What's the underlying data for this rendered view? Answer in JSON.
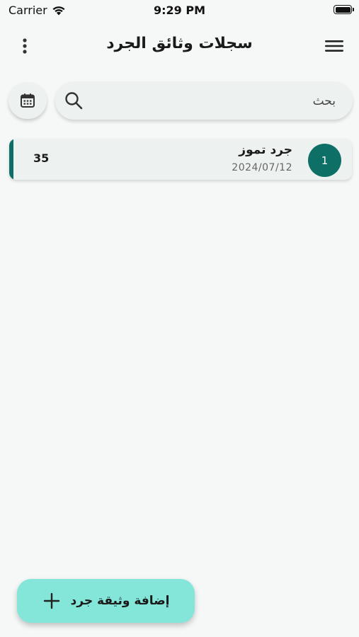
{
  "status_bar": {
    "carrier": "Carrier",
    "time": "9:29 PM"
  },
  "app_bar": {
    "title": "سجلات وثائق الجرد",
    "menu_icon": "hamburger-menu-icon",
    "more_icon": "more-vertical-icon"
  },
  "search": {
    "placeholder": "بحث",
    "icon": "search-icon",
    "calendar_icon": "calendar-icon"
  },
  "records": [
    {
      "index": "1",
      "title": "جرد تموز",
      "date": "2024/07/12",
      "count": "35"
    }
  ],
  "fab": {
    "label": "إضافة وثيقة جرد",
    "icon": "plus-icon"
  },
  "colors": {
    "background": "#f6f8f8",
    "card": "#edf1f0",
    "accent": "#0e6f66",
    "fab": "#83e6d9"
  }
}
